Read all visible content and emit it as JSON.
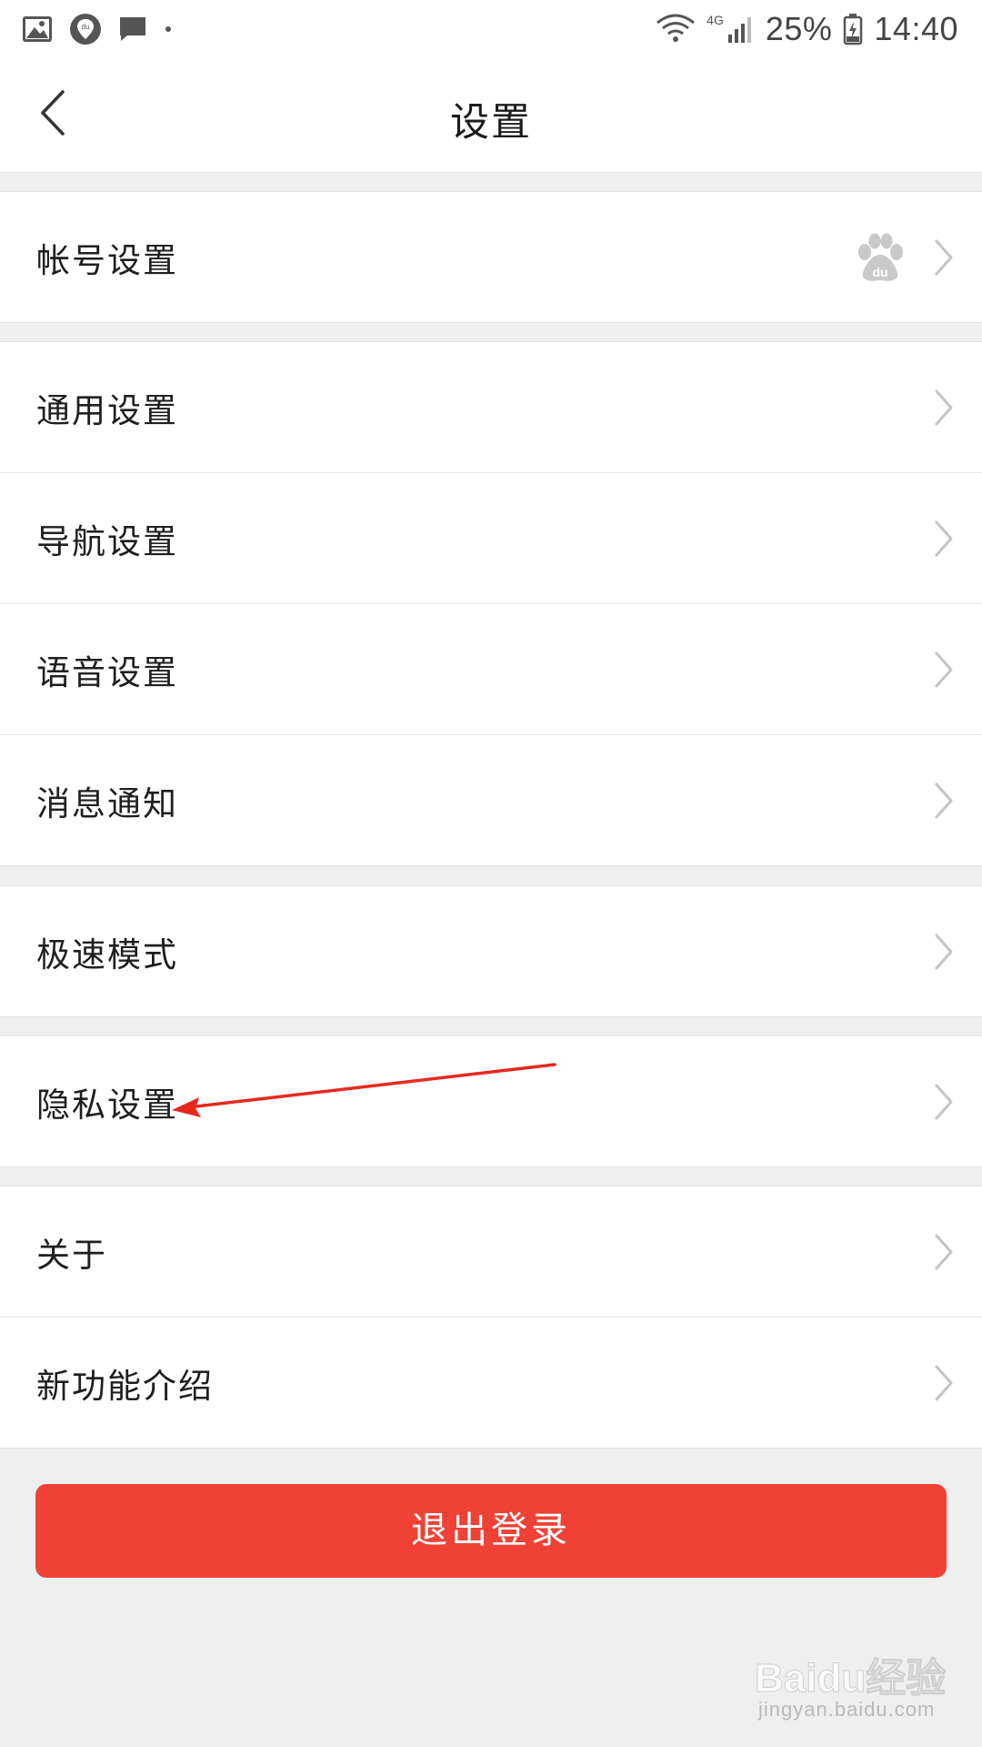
{
  "status_bar": {
    "battery": "25%",
    "time": "14:40",
    "network": "4G",
    "icons": [
      "gallery-icon",
      "baidu-maps-icon",
      "message-icon",
      "dot-icon",
      "wifi-icon",
      "signal-icon",
      "battery-icon"
    ]
  },
  "header": {
    "title": "设置",
    "back_icon": "chevron-left-icon"
  },
  "groups": [
    {
      "items": [
        {
          "label": "帐号设置",
          "badge_icon": "baidu-paw-icon"
        }
      ]
    },
    {
      "items": [
        {
          "label": "通用设置"
        },
        {
          "label": "导航设置"
        },
        {
          "label": "语音设置"
        },
        {
          "label": "消息通知"
        }
      ]
    },
    {
      "items": [
        {
          "label": "极速模式"
        }
      ]
    },
    {
      "items": [
        {
          "label": "隐私设置"
        }
      ]
    },
    {
      "items": [
        {
          "label": "关于"
        },
        {
          "label": "新功能介绍"
        }
      ]
    }
  ],
  "logout": {
    "label": "退出登录"
  },
  "watermark": {
    "main": "Baidu经验",
    "sub": "jingyan.baidu.com"
  },
  "colors": {
    "background": "#f0efef",
    "logout": "#f04136",
    "annotation_arrow": "#e8281f"
  }
}
